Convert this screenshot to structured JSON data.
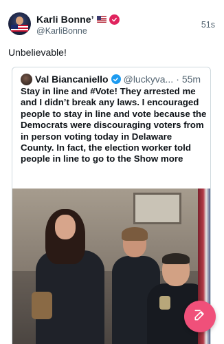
{
  "author": {
    "display_name": "Karli Bonne’",
    "handle": "@KarliBonne",
    "timestamp": "51s"
  },
  "post": {
    "text": "Unbelievable!"
  },
  "quoted_post": {
    "display_name": "Val Biancaniello",
    "handle": "@luckyva...",
    "separator": "·",
    "timestamp": "55m",
    "body": "Stay in line and #Vote!  They arrested me and I didn’t break any laws.  I encouraged people to stay in line and vote because the Democrats were discouraging voters from in person voting today in Delaware County.  In fact, the election worker told people in line to go to the",
    "show_more": "Show more"
  },
  "colors": {
    "compose_button": "#f0507a",
    "verified_blue": "#1d9bf0",
    "badge_pink": "#e0245e"
  },
  "icons": {
    "author_avatar": "profile-photo",
    "flag": "us-flag-icon",
    "badge": "verified-badge-icon",
    "quoted_verified": "verified-check-icon",
    "compose": "compose-pencil-icon"
  }
}
